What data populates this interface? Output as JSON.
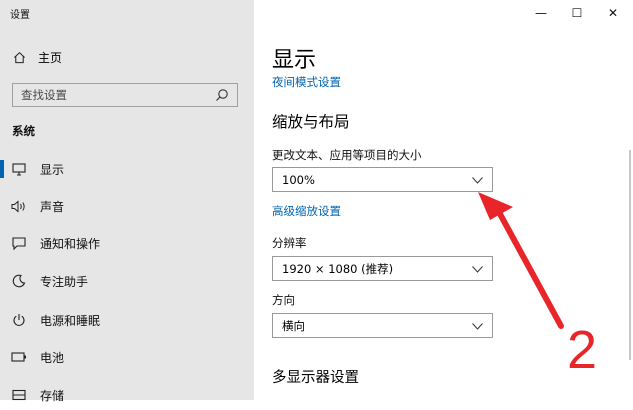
{
  "window": {
    "title": "设置",
    "controls": {
      "minimize": "—",
      "maximize": "☐",
      "close": "✕"
    }
  },
  "sidebar": {
    "home_label": "主页",
    "search_placeholder": "查找设置",
    "section_title": "系统",
    "items": [
      {
        "label": "显示",
        "icon": "monitor-icon",
        "active": true
      },
      {
        "label": "声音",
        "icon": "speaker-icon"
      },
      {
        "label": "通知和操作",
        "icon": "notification-icon"
      },
      {
        "label": "专注助手",
        "icon": "moon-icon"
      },
      {
        "label": "电源和睡眠",
        "icon": "power-icon"
      },
      {
        "label": "电池",
        "icon": "battery-icon"
      },
      {
        "label": "存储",
        "icon": "storage-icon"
      }
    ]
  },
  "main": {
    "title": "显示",
    "night_light_link": "夜间模式设置",
    "scale_section": "缩放与布局",
    "scale_label": "更改文本、应用等项目的大小",
    "scale_value": "100%",
    "advanced_scaling_link": "高级缩放设置",
    "resolution_label": "分辨率",
    "resolution_value": "1920 × 1080 (推荐)",
    "orientation_label": "方向",
    "orientation_value": "横向",
    "multi_display_section": "多显示器设置"
  },
  "annotation": {
    "number": "2",
    "color": "#e8262a"
  },
  "colors": {
    "accent": "#0063b1",
    "sidebar_bg": "#e6e6e6"
  }
}
